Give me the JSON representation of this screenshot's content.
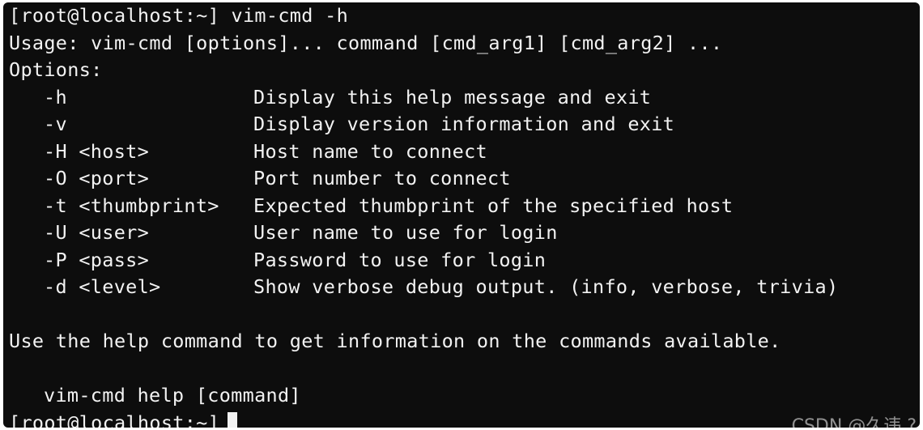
{
  "terminal": {
    "command_line": {
      "prompt": "[root@localhost:~]",
      "command": "vim-cmd -h"
    },
    "usage_line": "Usage: vim-cmd [options]... command [cmd_arg1] [cmd_arg2] ...",
    "options_header": "Options:",
    "options": [
      {
        "flag": "-h",
        "description": "Display this help message and exit"
      },
      {
        "flag": "-v",
        "description": "Display version information and exit"
      },
      {
        "flag": "-H <host>",
        "description": "Host name to connect"
      },
      {
        "flag": "-O <port>",
        "description": "Port number to connect"
      },
      {
        "flag": "-t <thumbprint>",
        "description": "Expected thumbprint of the specified host"
      },
      {
        "flag": "-U <user>",
        "description": "User name to use for login"
      },
      {
        "flag": "-P <pass>",
        "description": "Password to use for login"
      },
      {
        "flag": "-d <level>",
        "description": "Show verbose debug output. (info, verbose, trivia)"
      }
    ],
    "help_hint": "Use the help command to get information on the commands available.",
    "help_example": "vim-cmd help [command]",
    "final_prompt": "[root@localhost:~]"
  },
  "watermark": "CSDN @久违 ?"
}
